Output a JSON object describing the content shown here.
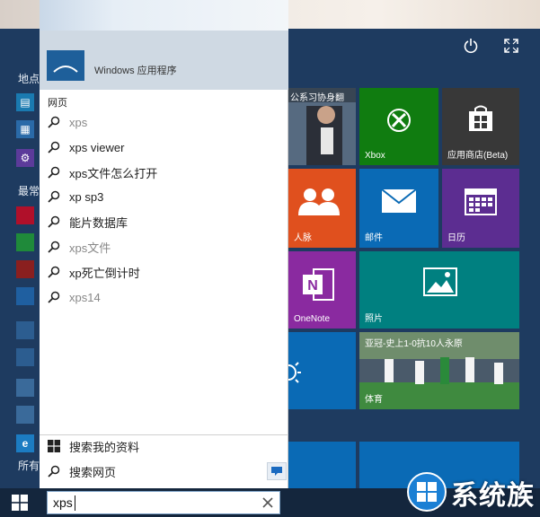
{
  "start_menu": {
    "left_labels": [
      "地点",
      "最常",
      "所有"
    ],
    "tiles": [
      {
        "id": "news",
        "label": "公系习协身翻"
      },
      {
        "id": "xbox",
        "label": "Xbox"
      },
      {
        "id": "store",
        "label": "应用商店(Beta)"
      },
      {
        "id": "people",
        "label": "人脉"
      },
      {
        "id": "mail",
        "label": "邮件"
      },
      {
        "id": "calendar",
        "label": "日历"
      },
      {
        "id": "onenote",
        "label": "OneNote"
      },
      {
        "id": "photos",
        "label": "照片"
      },
      {
        "id": "weather",
        "label": ""
      },
      {
        "id": "sports",
        "label": "体育",
        "headline": "亚冠-史上1-0抗10人永原"
      }
    ]
  },
  "search_panel": {
    "best_match_label": "Windows 应用程序",
    "section_web": "网页",
    "suggestions": [
      {
        "text": "xps",
        "gray": true
      },
      {
        "text": "xps viewer",
        "gray": false
      },
      {
        "text": "xps文件怎么打开",
        "gray": false
      },
      {
        "text": "xp sp3",
        "gray": false
      },
      {
        "text": "能片数据库",
        "gray": false
      },
      {
        "text": "xps文件",
        "gray": true
      },
      {
        "text": "xp死亡倒计时",
        "gray": false
      },
      {
        "text": "xps14",
        "gray": true
      }
    ],
    "bottom_items": [
      {
        "text": "搜索我的资料",
        "icon": "windows-icon"
      },
      {
        "text": "搜索网页",
        "icon": "search-icon"
      }
    ]
  },
  "taskbar": {
    "search_value": "xps"
  },
  "watermark": {
    "text": "系统族"
  },
  "colors": {
    "start_bg": "#1e3b60",
    "green": "#107c10",
    "orange": "#e0501e",
    "blue": "#0a6ab5",
    "purple": "#5c2d91",
    "teal": "#008080",
    "onenote": "#8a2aa0"
  }
}
